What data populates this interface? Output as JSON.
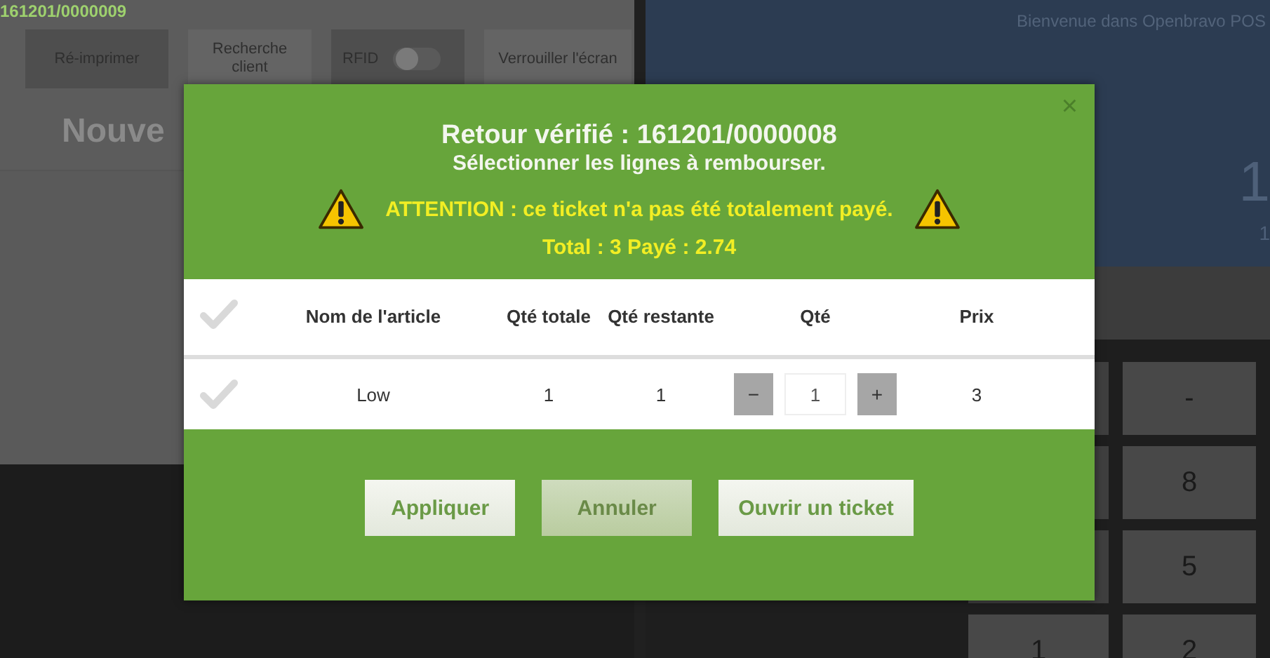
{
  "background": {
    "ticket_number": "161201/0000009",
    "toolbar": [
      {
        "label": "Ré-imprimer",
        "highlighted": true,
        "kind": "button"
      },
      {
        "label": "Recherche client",
        "highlighted": false,
        "kind": "button"
      },
      {
        "label": "RFID",
        "highlighted": true,
        "kind": "toggle",
        "on": false
      },
      {
        "label": "Verrouiller l'écran",
        "highlighted": false,
        "kind": "button"
      }
    ],
    "heading": "Nouve",
    "welcome": "Bienvenue dans Openbravo POS",
    "total_large": "1",
    "total_small": "1",
    "keypad": [
      {
        "kind": "blank"
      },
      {
        "kind": "key",
        "label": "-"
      },
      {
        "kind": "blank"
      },
      {
        "kind": "key",
        "label": "8"
      },
      {
        "kind": "blank"
      },
      {
        "kind": "key",
        "label": "5"
      },
      {
        "kind": "key",
        "label": "1"
      },
      {
        "kind": "key",
        "label": "2"
      }
    ]
  },
  "dialog": {
    "close": "×",
    "title": "Retour vérifié : 161201/0000008",
    "subtitle": "Sélectionner les lignes à rembourser.",
    "warning": "ATTENTION : ce ticket n'a pas été totalement payé.",
    "totals": "Total : 3 Payé : 2.74",
    "table": {
      "select_all_checked": false,
      "columns": [
        "Nom de l'article",
        "Qté totale",
        "Qté restante",
        "Qté",
        "Prix"
      ],
      "rows": [
        {
          "checked": false,
          "name": "Low",
          "total_qty": "1",
          "remaining_qty": "1",
          "decrement": "−",
          "qty": "1",
          "increment": "+",
          "price": "3"
        }
      ]
    },
    "buttons": [
      {
        "label": "Appliquer",
        "hovered": false
      },
      {
        "label": "Annuler",
        "hovered": true
      },
      {
        "label": "Ouvrir un ticket",
        "hovered": false
      }
    ]
  }
}
